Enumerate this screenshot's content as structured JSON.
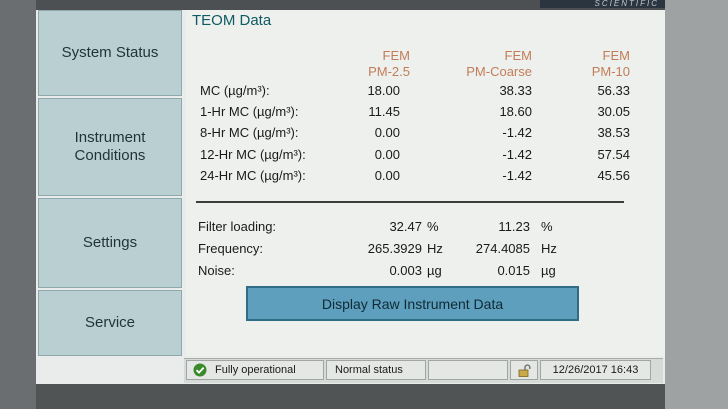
{
  "brand": "SCIENTIFIC",
  "sidebar": {
    "items": [
      {
        "label": "System Status"
      },
      {
        "label": "Instrument Conditions"
      },
      {
        "label": "Settings"
      },
      {
        "label": "Service"
      }
    ]
  },
  "main": {
    "title": "TEOM Data",
    "columns": [
      {
        "line1": "FEM",
        "line2": "PM-2.5"
      },
      {
        "line1": "FEM",
        "line2": "PM-Coarse"
      },
      {
        "line1": "FEM",
        "line2": "PM-10"
      }
    ],
    "rows": [
      {
        "label": "MC (µg/m³):",
        "values": [
          "18.00",
          "38.33",
          "56.33"
        ]
      },
      {
        "label": "1-Hr MC (µg/m³):",
        "values": [
          "11.45",
          "18.60",
          "30.05"
        ]
      },
      {
        "label": "8-Hr MC (µg/m³):",
        "values": [
          "0.00",
          "-1.42",
          "38.53"
        ]
      },
      {
        "label": "12-Hr MC (µg/m³):",
        "values": [
          "0.00",
          "-1.42",
          "57.54"
        ]
      },
      {
        "label": "24-Hr MC (µg/m³):",
        "values": [
          "0.00",
          "-1.42",
          "45.56"
        ]
      }
    ],
    "stats": [
      {
        "label": "Filter loading:",
        "v1": "32.47",
        "u1": "%",
        "v2": "11.23",
        "u2": "%"
      },
      {
        "label": "Frequency:",
        "v1": "265.3929",
        "u1": "Hz",
        "v2": "274.4085",
        "u2": "Hz"
      },
      {
        "label": "Noise:",
        "v1": "0.003",
        "u1": "µg",
        "v2": "0.015",
        "u2": "µg"
      }
    ],
    "raw_button": "Display Raw Instrument Data"
  },
  "status_bar": {
    "operational": "Fully operational",
    "status": "Normal status",
    "datetime": "12/26/2017 16:43"
  },
  "colors": {
    "accent": "#5d9fbd",
    "nav": "#b9cfd2",
    "header": "#c27d58",
    "ok": "#3a8a2c"
  }
}
